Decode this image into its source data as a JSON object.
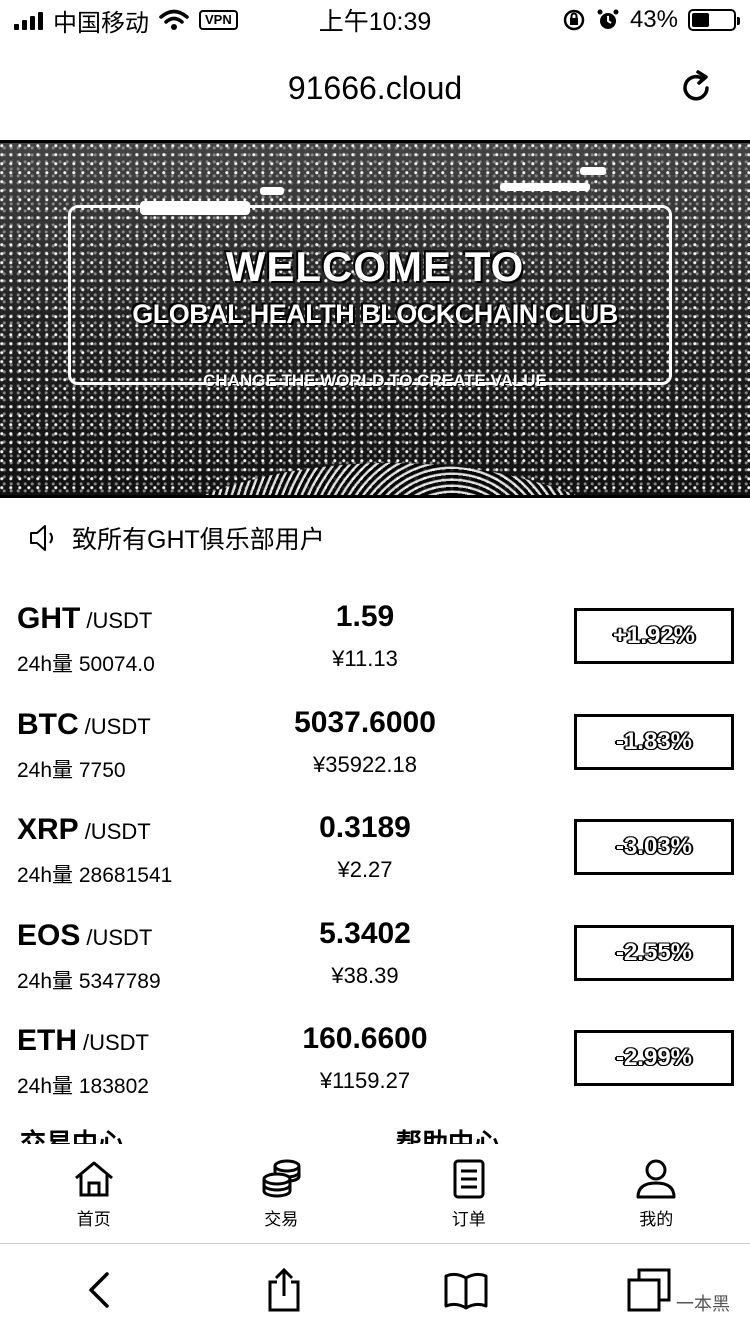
{
  "status_bar": {
    "carrier": "中国移动",
    "vpn": "VPN",
    "time": "上午10:39",
    "battery": "43%",
    "battery_level": 0.43
  },
  "browser": {
    "url": "91666.cloud"
  },
  "banner": {
    "title": "WELCOME TO",
    "subtitle": "GLOBAL HEALTH BLOCKCHAIN CLUB",
    "tagline": "CHANGE THE WORLD TO CREATE VALUE"
  },
  "notice": {
    "text": "致所有GHT俱乐部用户"
  },
  "market": [
    {
      "symbol": "GHT",
      "quote": "/USDT",
      "volume": "24h量 50074.0",
      "price": "1.59",
      "cny": "¥11.13",
      "change": "+1.92%"
    },
    {
      "symbol": "BTC",
      "quote": "/USDT",
      "volume": "24h量 7750",
      "price": "5037.6000",
      "cny": "¥35922.18",
      "change": "-1.83%"
    },
    {
      "symbol": "XRP",
      "quote": "/USDT",
      "volume": "24h量 28681541",
      "price": "0.3189",
      "cny": "¥2.27",
      "change": "-3.03%"
    },
    {
      "symbol": "EOS",
      "quote": "/USDT",
      "volume": "24h量 5347789",
      "price": "5.3402",
      "cny": "¥38.39",
      "change": "-2.55%"
    },
    {
      "symbol": "ETH",
      "quote": "/USDT",
      "volume": "24h量 183802",
      "price": "160.6600",
      "cny": "¥1159.27",
      "change": "-2.99%"
    }
  ],
  "sections_cut": {
    "left": "交易中心",
    "right": "帮助中心"
  },
  "tabbar": {
    "items": [
      {
        "label": "首页",
        "icon": "home-icon"
      },
      {
        "label": "交易",
        "icon": "coins-icon"
      },
      {
        "label": "订单",
        "icon": "order-icon"
      },
      {
        "label": "我的",
        "icon": "user-icon"
      }
    ]
  },
  "toolbar": {
    "icons": [
      "back-icon",
      "share-icon",
      "bookmarks-icon",
      "tabs-icon"
    ]
  },
  "watermark": "一本黑"
}
